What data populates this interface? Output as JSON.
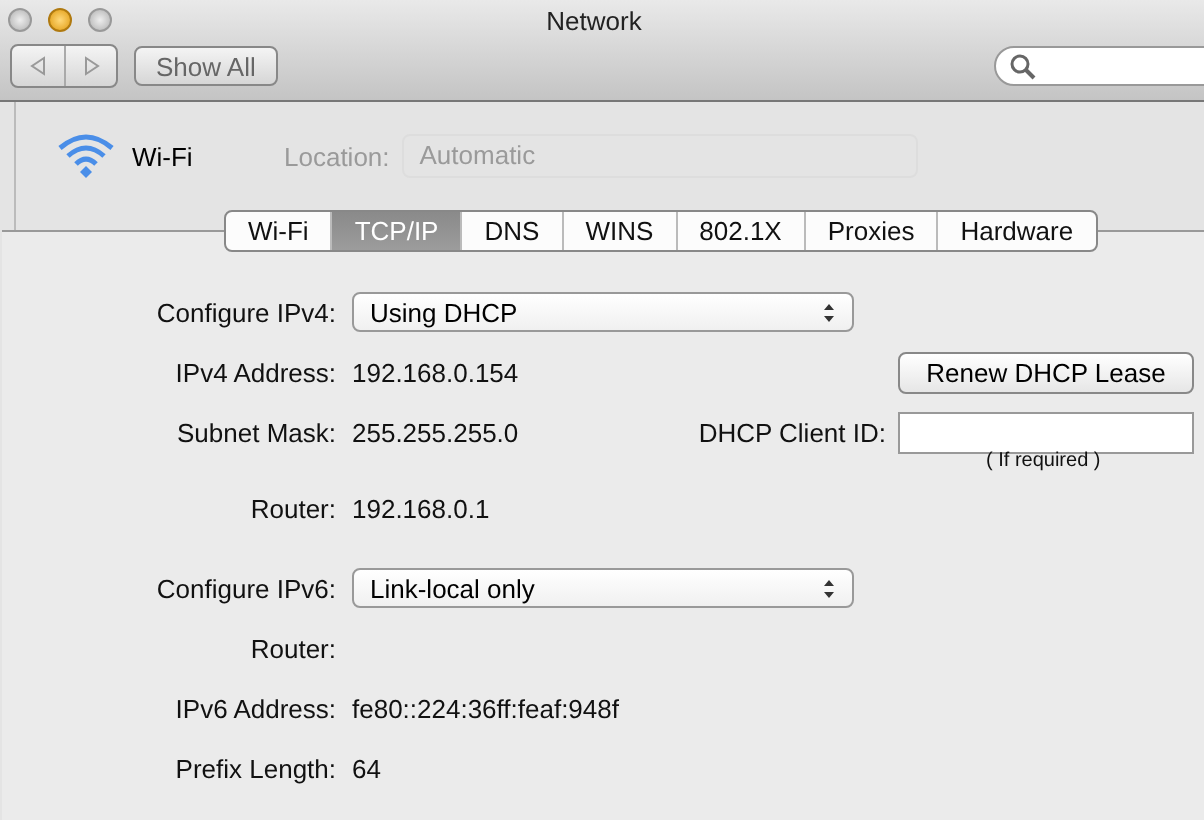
{
  "window": {
    "title": "Network"
  },
  "toolbar": {
    "show_all": "Show All"
  },
  "service": {
    "name": "Wi-Fi"
  },
  "location": {
    "label": "Location:",
    "value": "Automatic",
    "disabled": true
  },
  "tabs": [
    {
      "label": "Wi-Fi",
      "selected": false
    },
    {
      "label": "TCP/IP",
      "selected": true
    },
    {
      "label": "DNS",
      "selected": false
    },
    {
      "label": "WINS",
      "selected": false
    },
    {
      "label": "802.1X",
      "selected": false
    },
    {
      "label": "Proxies",
      "selected": false
    },
    {
      "label": "Hardware",
      "selected": false
    }
  ],
  "ipv4": {
    "configure_label": "Configure IPv4:",
    "configure_value": "Using DHCP",
    "address_label": "IPv4 Address:",
    "address": "192.168.0.154",
    "subnet_label": "Subnet Mask:",
    "subnet": "255.255.255.0",
    "router_label": "Router:",
    "router": "192.168.0.1",
    "renew_button": "Renew DHCP Lease",
    "client_id_label": "DHCP Client ID:",
    "client_id_hint": "( If required )"
  },
  "ipv6": {
    "configure_label": "Configure IPv6:",
    "configure_value": "Link-local only",
    "router_label": "Router:",
    "address_label": "IPv6 Address:",
    "address": "fe80::224:36ff:feaf:948f",
    "prefix_label": "Prefix Length:",
    "prefix": "64"
  }
}
